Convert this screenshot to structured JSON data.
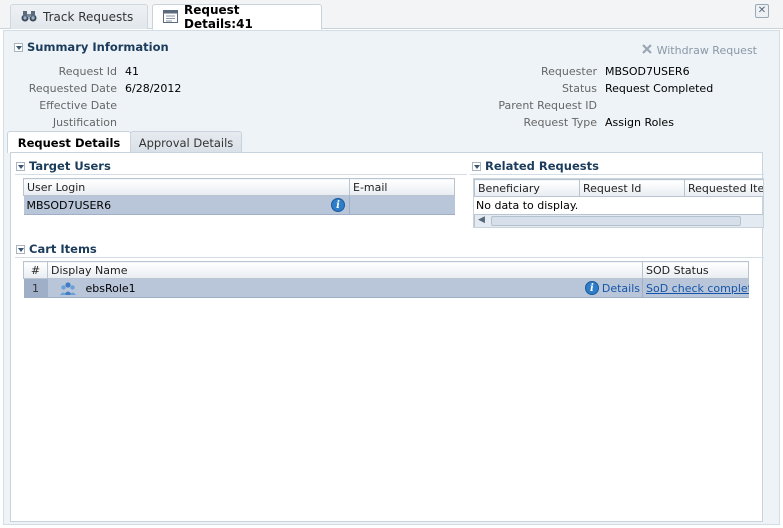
{
  "top_tabs": [
    {
      "label": "Track Requests",
      "icon": "binoculars-icon"
    },
    {
      "label": "Request Details:41",
      "icon": "calendar-icon"
    }
  ],
  "summary": {
    "title": "Summary Information",
    "withdraw_label": "Withdraw Request",
    "left": [
      {
        "label": "Request Id",
        "value": "41"
      },
      {
        "label": "Requested Date",
        "value": "6/28/2012"
      },
      {
        "label": "Effective Date",
        "value": ""
      },
      {
        "label": "Justification",
        "value": ""
      }
    ],
    "right": [
      {
        "label": "Requester",
        "value": "MBSOD7USER6"
      },
      {
        "label": "Status",
        "value": "Request Completed"
      },
      {
        "label": "Parent Request ID",
        "value": ""
      },
      {
        "label": "Request Type",
        "value": "Assign Roles"
      }
    ]
  },
  "sub_tabs": [
    {
      "label": "Request Details"
    },
    {
      "label": "Approval Details"
    }
  ],
  "target_users": {
    "title": "Target Users",
    "columns": [
      "User Login",
      "E-mail"
    ],
    "rows": [
      {
        "login": "MBSOD7USER6",
        "email": ""
      }
    ]
  },
  "related_requests": {
    "title": "Related Requests",
    "columns": [
      "Beneficiary",
      "Request Id",
      "Requested Ite"
    ],
    "empty_text": "No data to display."
  },
  "cart_items": {
    "title": "Cart Items",
    "columns": [
      "#",
      "Display Name",
      "SOD Status"
    ],
    "rows": [
      {
        "index": "1",
        "name": "ebsRole1",
        "details_label": "Details",
        "sod_status": "SoD check completed"
      }
    ]
  },
  "colors": {
    "accent": "#1c3c5c",
    "selected_row": "#b9c6d9",
    "link": "#1455a8"
  }
}
